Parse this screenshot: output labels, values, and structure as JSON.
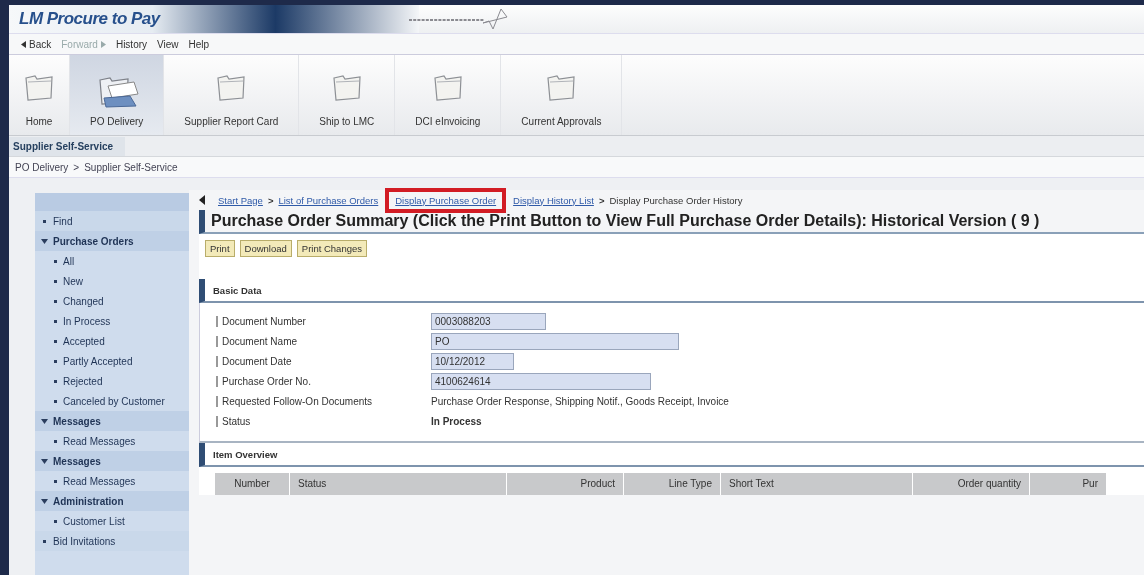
{
  "header": {
    "app_title": "LM Procure to Pay"
  },
  "menu": [
    {
      "label": "Back",
      "kind": "back",
      "disabled": false
    },
    {
      "label": "Forward",
      "kind": "forward",
      "disabled": true
    },
    {
      "label": "History",
      "kind": "plain",
      "disabled": false
    },
    {
      "label": "View",
      "kind": "plain",
      "disabled": false
    },
    {
      "label": "Help",
      "kind": "plain",
      "disabled": false
    }
  ],
  "nav_tabs": [
    {
      "label": "Home",
      "selected": false
    },
    {
      "label": "PO Delivery",
      "selected": true
    },
    {
      "label": "Supplier Report Card",
      "selected": false
    },
    {
      "label": "Ship to LMC",
      "selected": false
    },
    {
      "label": "DCI eInvoicing",
      "selected": false
    },
    {
      "label": "Current Approvals",
      "selected": false
    }
  ],
  "sub_tab": "Supplier Self-Service",
  "location_path": [
    {
      "label": "PO Delivery"
    },
    {
      "separator": ">",
      "label": "Supplier Self-Service"
    }
  ],
  "sidebar": {
    "items": [
      {
        "label": "Find",
        "expanded": false
      },
      {
        "label": "Purchase Orders",
        "expanded": true,
        "children": [
          {
            "label": "All"
          },
          {
            "label": "New"
          },
          {
            "label": "Changed"
          },
          {
            "label": "In Process"
          },
          {
            "label": "Accepted"
          },
          {
            "label": "Partly Accepted"
          },
          {
            "label": "Rejected"
          },
          {
            "label": "Canceled by Customer"
          }
        ]
      },
      {
        "label": "Messages",
        "expanded": true,
        "children": [
          {
            "label": "Read Messages"
          }
        ]
      },
      {
        "label": "Messages",
        "expanded": true,
        "children": [
          {
            "label": "Read Messages"
          }
        ]
      },
      {
        "label": "Administration",
        "expanded": true,
        "children": [
          {
            "label": "Customer List"
          }
        ]
      },
      {
        "label": "Bid Invitations",
        "expanded": false
      }
    ]
  },
  "breadcrumb": [
    {
      "label": "Start Page",
      "link": true,
      "highlighted": false
    },
    {
      "separator": ">",
      "label": "List of Purchase Orders",
      "link": true,
      "highlighted": false
    },
    {
      "label": "Display Purchase Order",
      "link": true,
      "highlighted": true
    },
    {
      "label": "Display History List",
      "link": true,
      "highlighted": false
    },
    {
      "separator": ">",
      "label": "Display Purchase Order History",
      "link": false,
      "highlighted": false
    }
  ],
  "page_title": "Purchase Order Summary (Click the Print Button to View Full Purchase Order Details): Historical Version ( 9 )",
  "buttons": [
    "Print",
    "Download",
    "Print Changes"
  ],
  "basic_data": {
    "title": "Basic Data",
    "fields": [
      {
        "label": "Document Number",
        "value": "0003088203",
        "kind": "input"
      },
      {
        "label": "Document Name",
        "value": "PO",
        "kind": "input"
      },
      {
        "label": "Document Date",
        "value": "10/12/2012",
        "kind": "input"
      },
      {
        "label": "Purchase Order No.",
        "value": "4100624614",
        "kind": "input"
      },
      {
        "label": "Requested Follow-On Documents",
        "value": "Purchase Order Response, Shipping Notif., Goods Receipt, Invoice",
        "kind": "text"
      },
      {
        "label": "Status",
        "value": "In Process",
        "kind": "bold"
      }
    ]
  },
  "item_overview": {
    "title": "Item Overview",
    "columns": [
      "Number",
      "Status",
      "Product",
      "Line Type",
      "Short Text",
      "Order quantity",
      "Pur"
    ]
  }
}
